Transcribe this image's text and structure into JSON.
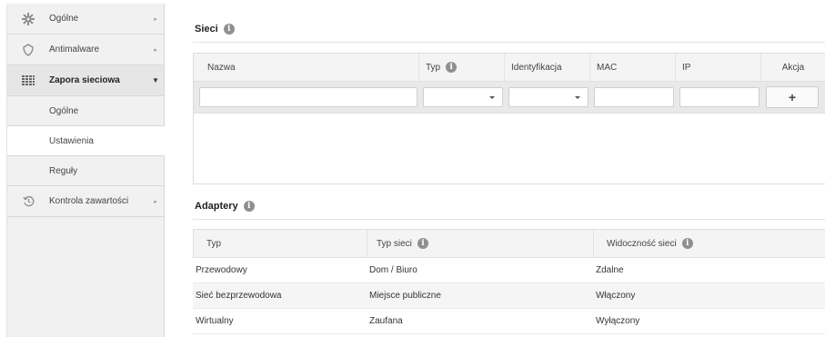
{
  "sidebar": {
    "items": [
      {
        "label": "Ogólne",
        "icon": "gear-icon"
      },
      {
        "label": "Antimalware",
        "icon": "shield-icon"
      },
      {
        "label": "Zapora sieciowa",
        "icon": "firewall-grid-icon"
      },
      {
        "label": "Kontrola zawartości",
        "icon": "history-icon"
      }
    ],
    "subitems": [
      {
        "label": "Ogólne"
      },
      {
        "label": "Ustawienia"
      },
      {
        "label": "Reguły"
      }
    ]
  },
  "networks": {
    "title": "Sieci",
    "columns": [
      "Nazwa",
      "Typ",
      "Identyfikacja",
      "MAC",
      "IP",
      "Akcja"
    ],
    "add_label": "+"
  },
  "adapters": {
    "title": "Adaptery",
    "columns": [
      "Typ",
      "Typ sieci",
      "Widoczność sieci"
    ],
    "rows": [
      [
        "Przewodowy",
        "Dom / Biuro",
        "Zdalne"
      ],
      [
        "Sieć bezprzewodowa",
        "Miejsce publiczne",
        "Włączony"
      ],
      [
        "Wirtualny",
        "Zaufana",
        "Wyłączony"
      ]
    ]
  },
  "colors": {
    "sidebar_bg": "#f1f1f1",
    "header_bg": "#f4f4f4",
    "info_icon": "#8f8f8f"
  }
}
